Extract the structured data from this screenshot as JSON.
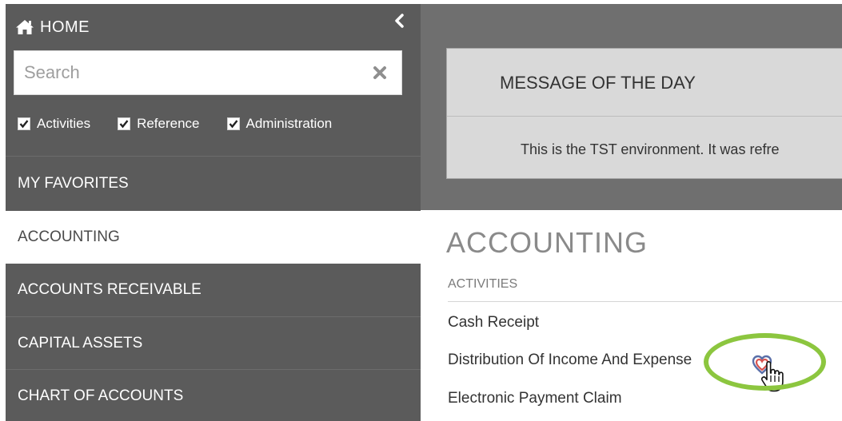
{
  "sidebar": {
    "home_label": "HOME",
    "search": {
      "placeholder": "Search",
      "value": ""
    },
    "filters": [
      {
        "label": "Activities",
        "checked": true
      },
      {
        "label": "Reference",
        "checked": true
      },
      {
        "label": "Administration",
        "checked": true
      }
    ],
    "items": [
      {
        "label": "MY FAVORITES"
      },
      {
        "label": "ACCOUNTING",
        "active": true
      },
      {
        "label": "ACCOUNTS RECEIVABLE"
      },
      {
        "label": "CAPITAL ASSETS"
      },
      {
        "label": "CHART OF ACCOUNTS"
      }
    ]
  },
  "message_of_day": {
    "title": "MESSAGE OF THE DAY",
    "text": "This is the TST environment. It was refre"
  },
  "main": {
    "title": "ACCOUNTING",
    "section_label": "ACTIVITIES",
    "activities": [
      {
        "label": "Cash Receipt"
      },
      {
        "label": "Distribution Of Income And Expense"
      },
      {
        "label": "Electronic Payment Claim"
      }
    ]
  },
  "icons": {
    "home": "home-icon",
    "collapse": "chevron-left-icon",
    "clear": "clear-x-icon",
    "favorite": "favorite-heart-icon",
    "cursor": "hand-pointer-icon"
  },
  "colors": {
    "sidebar_bg": "#5b5b5b",
    "overlay_bg": "#6f6f6f",
    "highlight_ring": "#8cc63f",
    "favorite_heart": "#d9534f"
  }
}
